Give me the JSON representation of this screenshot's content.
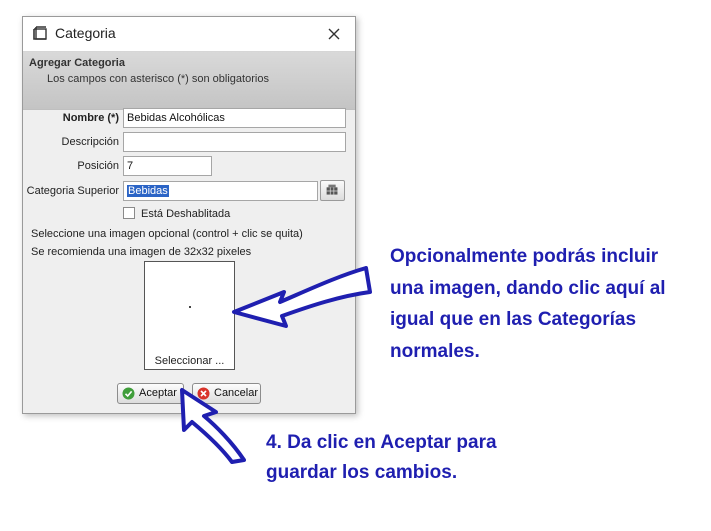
{
  "window": {
    "title": "Categoria",
    "close_glyph": "✕"
  },
  "header": {
    "title": "Agregar Categoria",
    "subtitle": "Los campos con asterisco (*) son obligatorios"
  },
  "form": {
    "nombre_label": "Nombre (*)",
    "nombre_value": "Bebidas Alcohólicas",
    "descripcion_label": "Descripción",
    "descripcion_value": "",
    "posicion_label": "Posición",
    "posicion_value": "7",
    "categoria_superior_label": "Categoria Superior",
    "categoria_superior_value": "Bebidas",
    "deshabilitada_label": "Está Deshablitada",
    "image_hint_1": "Seleccione una imagen opcional (control + clic se quita)",
    "image_hint_2": "Se recomienda una imagen de 32x32 pixeles",
    "image_button_label": "Seleccionar ..."
  },
  "buttons": {
    "accept_label": "Aceptar",
    "cancel_label": "Cancelar"
  },
  "annotations": {
    "image_note": [
      "Opcionalmente podrás incluir",
      "una imagen, dando clic aquí al",
      "igual que en las Categorías",
      "normales."
    ],
    "accept_note": [
      "4. Da clic en Aceptar para",
      "guardar los cambios."
    ]
  },
  "colors": {
    "annotation_text": "#1f1fb0",
    "arrow_fill": "#1f1fb0",
    "selection": "#2b64c6"
  },
  "icons": {
    "app": "app-window-icon",
    "close": "close-icon",
    "lookup": "grid-lookup-icon",
    "accept": "green-check-icon",
    "cancel": "red-x-icon"
  }
}
